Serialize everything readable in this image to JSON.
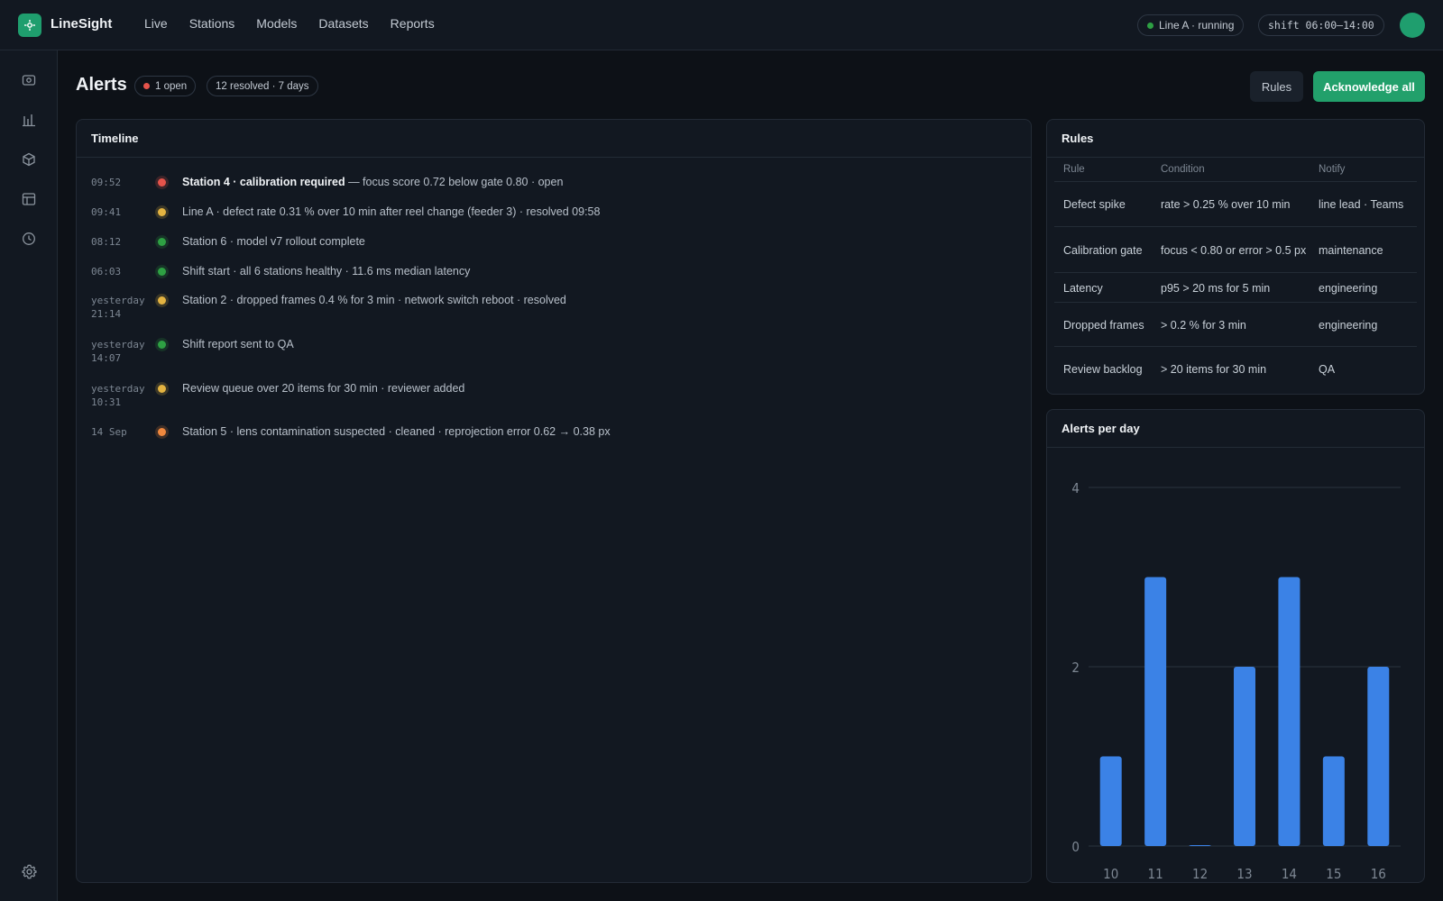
{
  "app": {
    "name": "LineSight"
  },
  "nav": [
    "Live",
    "Stations",
    "Models",
    "Datasets",
    "Reports"
  ],
  "status": {
    "line_label": "Line A · running",
    "shift_label": "shift 06:00–14:00"
  },
  "page": {
    "title": "Alerts",
    "open_badge": "1 open",
    "resolved_badge": "12 resolved · 7 days",
    "rules_button": "Rules",
    "ack_button": "Acknowledge all"
  },
  "timeline": {
    "title": "Timeline",
    "events": [
      {
        "time": "09:52",
        "severity": "red",
        "bold": "Station 4 · calibration required",
        "text": " — focus score 0.72 below gate 0.80 · open"
      },
      {
        "time": "09:41",
        "severity": "amber",
        "bold": "",
        "text": "Line A · defect rate 0.31 % over 10 min after reel change (feeder 3) · resolved 09:58"
      },
      {
        "time": "08:12",
        "severity": "green",
        "bold": "",
        "text": "Station 6 · model v7 rollout complete"
      },
      {
        "time": "06:03",
        "severity": "green",
        "bold": "",
        "text": "Shift start · all 6 stations healthy · 11.6 ms median latency"
      },
      {
        "time": "yesterday\n21:14",
        "severity": "amber",
        "bold": "",
        "text": "Station 2 · dropped frames 0.4 % for 3 min · network switch reboot · resolved"
      },
      {
        "time": "yesterday\n14:07",
        "severity": "green",
        "bold": "",
        "text": "Shift report sent to QA"
      },
      {
        "time": "yesterday\n10:31",
        "severity": "amber",
        "bold": "",
        "text": "Review queue over 20 items for 30 min · reviewer added"
      },
      {
        "time": "14 Sep",
        "severity": "orange",
        "bold": "",
        "text": "Station 5 · lens contamination suspected · cleaned · reprojection error 0.62 → 0.38 px"
      }
    ]
  },
  "severity_colors": {
    "red": "#e5534b",
    "amber": "#e3b341",
    "green": "#2ea043",
    "orange": "#f0883e"
  },
  "rules": {
    "title": "Rules",
    "columns": [
      "Rule",
      "Condition",
      "Notify"
    ],
    "rows": [
      {
        "rule": "Defect spike",
        "condition": "rate > 0.25 % over 10 min",
        "notify": "line lead · Teams"
      },
      {
        "rule": "Calibration gate",
        "condition": "focus < 0.80 or error > 0.5 px",
        "notify": "maintenance"
      },
      {
        "rule": "Latency",
        "condition": "p95 > 20 ms for 5 min",
        "notify": "engineering"
      },
      {
        "rule": "Dropped frames",
        "condition": "> 0.2 % for 3 min",
        "notify": "engineering"
      },
      {
        "rule": "Review backlog",
        "condition": "> 20 items for 30 min",
        "notify": "QA"
      }
    ]
  },
  "alerts_chart": {
    "title": "Alerts per day"
  },
  "chart_data": {
    "type": "bar",
    "categories": [
      "10",
      "11",
      "12",
      "13",
      "14",
      "15",
      "16"
    ],
    "values": [
      1,
      3,
      0,
      2,
      3,
      1,
      2
    ],
    "yticks": [
      0,
      2,
      4
    ],
    "ylim": [
      0,
      4
    ],
    "grid": true,
    "color": "#3b82e6"
  },
  "colors": {
    "accent": "#22a06b",
    "background": "#0d1117",
    "panel": "#121821"
  }
}
